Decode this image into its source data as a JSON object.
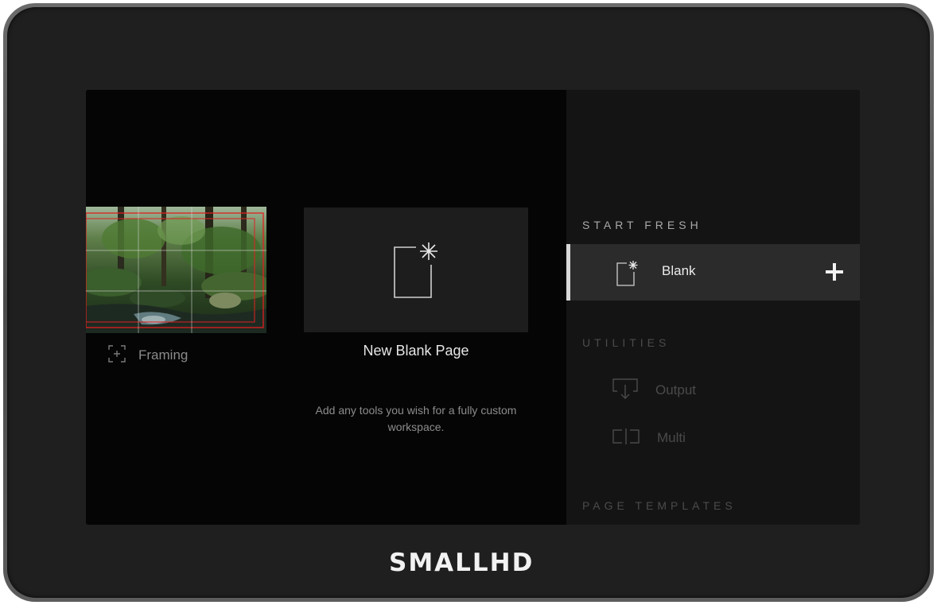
{
  "device": {
    "brand_logo": "SMALLHD"
  },
  "left": {
    "framing": {
      "label": "Framing",
      "icon": "framing-icon"
    },
    "new_blank": {
      "title": "New Blank Page",
      "description": "Add any tools you wish for a fully custom workspace.",
      "icon": "blank-page-icon"
    }
  },
  "panel": {
    "start_fresh_heading": "START FRESH",
    "blank_item": {
      "label": "Blank",
      "icon": "blank-page-icon",
      "action_icon": "plus-icon"
    },
    "utilities_heading": "UTILITIES",
    "utilities": [
      {
        "label": "Output",
        "icon": "output-icon"
      },
      {
        "label": "Multi",
        "icon": "multi-icon"
      }
    ],
    "page_templates_heading": "PAGE TEMPLATES"
  },
  "colors": {
    "screen_bg": "#060606",
    "panel_bg": "#141414",
    "selected_row_bg": "#2b2b2b",
    "framing_guides": "#e02020"
  }
}
